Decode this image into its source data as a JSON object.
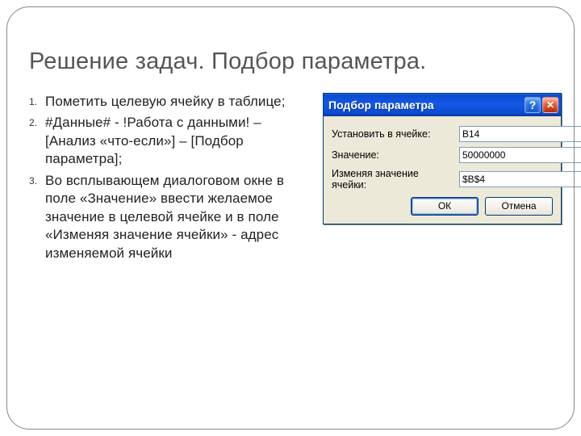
{
  "title": "Решение задач. Подбор параметра.",
  "list": {
    "item1": "Пометить целевую ячейку в таблице;",
    "item2": "#Данные# - !Работа с данными! – [Анализ «что-если»] – [Подбор параметра];",
    "item3": "Во всплывающем диалоговом окне в поле «Значение» ввести желаемое значение в целевой ячейке и в поле «Изменяя значение ячейки» - адрес изменяемой ячейки"
  },
  "dialog": {
    "title": "Подбор параметра",
    "labels": {
      "setCell": "Установить в ячейке:",
      "value": "Значение:",
      "changing": "Изменяя значение ячейки:"
    },
    "values": {
      "setCell": "B14",
      "value": "50000000",
      "changing": "$B$4"
    },
    "buttons": {
      "ok": "ОК",
      "cancel": "Отмена"
    },
    "help_symbol": "?",
    "close_symbol": "✕"
  }
}
